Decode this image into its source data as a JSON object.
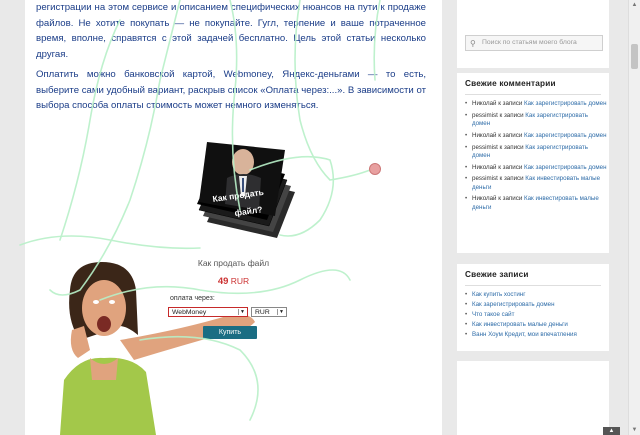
{
  "article": {
    "para1": "регистрации на этом сервисе и описанием специфических нюансов на пути к продаже файлов. Не хотите покупать — не покупайте. Гугл, терпение и ваше потраченное время, вполне, справятся с этой задачей бесплатно. Цель этой статьи несколько другая.",
    "para2": "Оплатить можно банковской картой, Webmoney, Яндекс-деньгами — то есть, выберите сами удобный вариант, раскрыв список «Оплата через:...». В зависимости от выбора способа оплаты стоимость может немного изменяться."
  },
  "product": {
    "book_text_1": "Как продать",
    "book_text_2": "файл?",
    "title": "Как продать файл",
    "price_value": "49",
    "price_currency": "RUR",
    "pay_label": "оплата через:",
    "method_selected": "WebMoney",
    "currency_selected": "RUR",
    "buy_label": "Купить"
  },
  "sidebar": {
    "search_placeholder": "Поиск по статьям моего блога",
    "comments_title": "Свежие комментарии",
    "comments": [
      {
        "author": "Николай",
        "sep": " к записи ",
        "post": "Как зарегистрировать домен"
      },
      {
        "author": "pessimist",
        "sep": " к записи ",
        "post": "Как зарегистрировать домен"
      },
      {
        "author": "Николай",
        "sep": " к записи ",
        "post": "Как зарегистрировать домен"
      },
      {
        "author": "pessimist",
        "sep": " к записи ",
        "post": "Как зарегистрировать домен"
      },
      {
        "author": "Николай",
        "sep": " к записи ",
        "post": "Как зарегистрировать домен"
      },
      {
        "author": "pessimist",
        "sep": " к записи ",
        "post": "Как инвестировать малые деньги"
      },
      {
        "author": "Николай",
        "sep": " к записи ",
        "post": "Как инвестировать малые деньги"
      }
    ],
    "posts_title": "Свежие записи",
    "posts": [
      "Как купить хостинг",
      "Как зарегистрировать домен",
      "Что такое сайт",
      "Как инвестировать малые деньги",
      "Ванн Хоум Кредит, мои впечатления"
    ]
  },
  "colors": {
    "text_blue": "#1b3d88",
    "link_blue": "#2e6ca8",
    "price_red": "#c33333",
    "buy_button": "#1a6d83",
    "sketch_green": "#b8f0c8"
  },
  "icons": {
    "search": "search-icon",
    "scroll_top": "chevron-up-icon"
  }
}
